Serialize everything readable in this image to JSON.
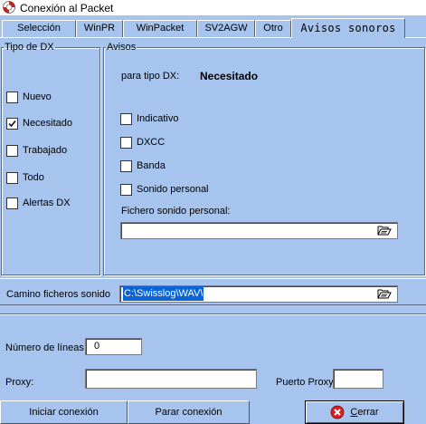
{
  "window": {
    "title": "Conexión al Packet"
  },
  "tabs": [
    {
      "label": "Selección"
    },
    {
      "label": "WinPR"
    },
    {
      "label": "WinPacket"
    },
    {
      "label": "SV2AGW"
    },
    {
      "label": "Otro"
    },
    {
      "label": "Avisos sonoros"
    }
  ],
  "tipo_dx": {
    "legend": "Tipo de DX",
    "items": [
      {
        "label": "Nuevo",
        "checked": false
      },
      {
        "label": "Necesitado",
        "checked": true
      },
      {
        "label": "Trabajado",
        "checked": false
      },
      {
        "label": "Todo",
        "checked": false
      },
      {
        "label": "Alertas DX",
        "checked": false
      }
    ]
  },
  "avisos": {
    "legend": "Avisos",
    "for_type_label": "para tipo DX:",
    "for_type_value": "Necesitado",
    "items": [
      {
        "label": "Indicativo",
        "checked": false
      },
      {
        "label": "DXCC",
        "checked": false
      },
      {
        "label": "Banda",
        "checked": false
      },
      {
        "label": "Sonido personal",
        "checked": false
      }
    ],
    "file_label": "Fichero sonido personal:",
    "file_value": ""
  },
  "sound_path": {
    "label": "Camino ficheros sonido",
    "value": "C:\\Swisslog\\WAV\\"
  },
  "connection": {
    "lines_label": "Número de líneas:",
    "lines_value": "0",
    "proxy_label": "Proxy:",
    "proxy_value": "",
    "proxy_port_label": "Puerto Proxy",
    "proxy_port_value": ""
  },
  "buttons": {
    "start": "Iniciar conexión",
    "stop": "Parar conexión",
    "close_prefix": "",
    "close_underlined": "C",
    "close_rest": "errar"
  },
  "icons": {
    "app": "lifebuoy-icon",
    "folder": "open-folder-icon",
    "close": "red-x-icon"
  },
  "colors": {
    "panel_bg": "#a6c4ee",
    "selection": "#0a64d8"
  }
}
